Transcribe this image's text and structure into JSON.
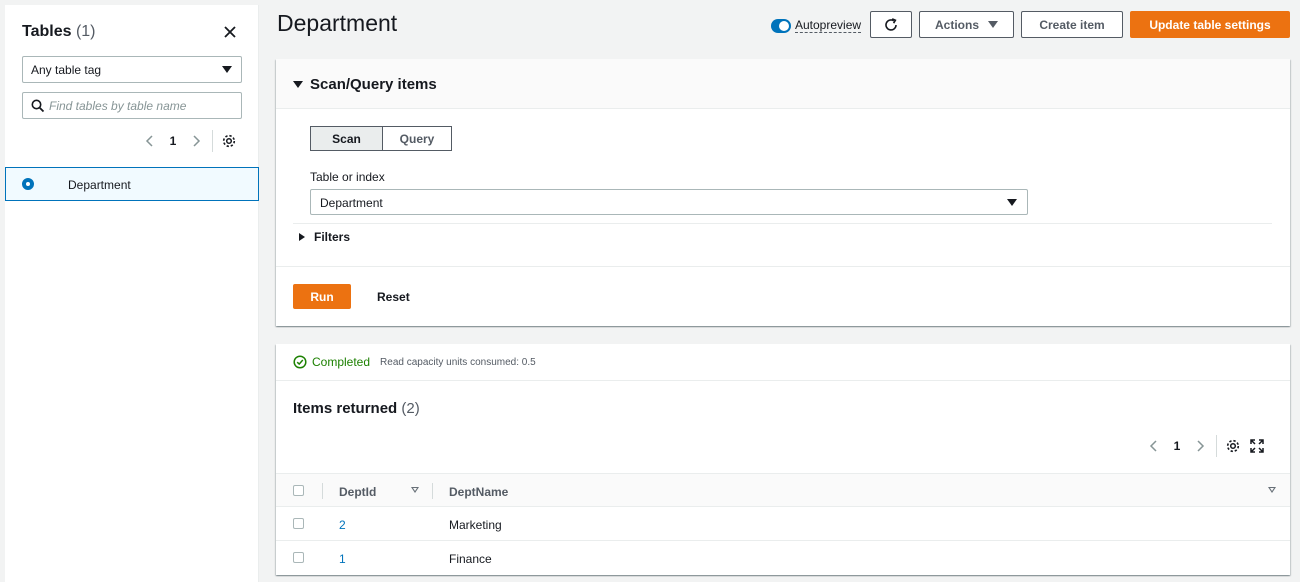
{
  "sidebar": {
    "title": "Tables",
    "count": "(1)",
    "tag_filter": "Any table tag",
    "search_placeholder": "Find tables by table name",
    "page": "1",
    "tables": [
      {
        "name": "Department",
        "selected": true
      }
    ]
  },
  "header": {
    "title": "Department",
    "autopreview_label": "Autopreview",
    "autopreview_on": true,
    "actions_label": "Actions",
    "create_item_label": "Create item",
    "update_settings_label": "Update table settings"
  },
  "scan_panel": {
    "title": "Scan/Query items",
    "modes": [
      "Scan",
      "Query"
    ],
    "active_mode": "Scan",
    "table_or_index_label": "Table or index",
    "table_or_index_value": "Department",
    "filters_label": "Filters",
    "run_label": "Run",
    "reset_label": "Reset"
  },
  "results": {
    "status": "Completed",
    "rcu_text": "Read capacity units consumed: 0.5",
    "title": "Items returned",
    "count": "(2)",
    "page": "1",
    "columns": [
      "DeptId",
      "DeptName"
    ],
    "rows": [
      {
        "DeptId": "2",
        "DeptName": "Marketing"
      },
      {
        "DeptId": "1",
        "DeptName": "Finance"
      }
    ]
  },
  "colors": {
    "accent": "#ec7211",
    "link": "#0073bb",
    "success": "#1d8102"
  }
}
